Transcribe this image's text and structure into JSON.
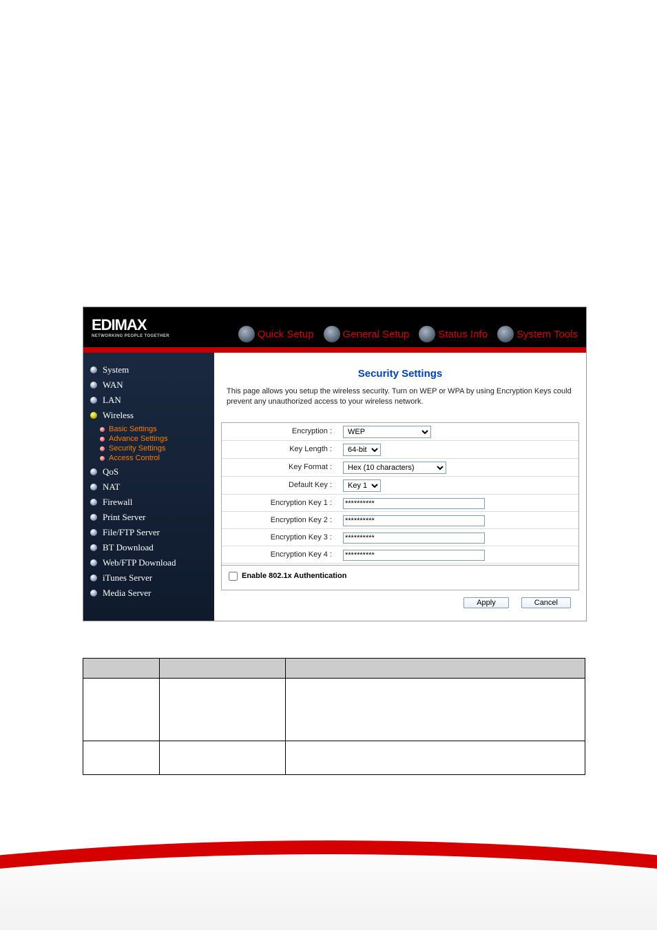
{
  "brand": {
    "name": "EDIMAX",
    "tagline": "NETWORKING PEOPLE TOGETHER"
  },
  "tabs": {
    "quick": "Quick Setup",
    "general": "General Setup",
    "status": "Status Info",
    "tools": "System Tools"
  },
  "sidebar": {
    "items": [
      {
        "label": "System"
      },
      {
        "label": "WAN"
      },
      {
        "label": "LAN"
      },
      {
        "label": "Wireless"
      },
      {
        "label": "QoS"
      },
      {
        "label": "NAT"
      },
      {
        "label": "Firewall"
      },
      {
        "label": "Print Server"
      },
      {
        "label": "File/FTP Server"
      },
      {
        "label": "BT Download"
      },
      {
        "label": "Web/FTP Download"
      },
      {
        "label": "iTunes Server"
      },
      {
        "label": "Media Server"
      }
    ],
    "wireless_sub": [
      {
        "label": "Basic Settings"
      },
      {
        "label": "Advance Settings"
      },
      {
        "label": "Security Settings"
      },
      {
        "label": "Access Control"
      }
    ]
  },
  "page": {
    "title": "Security Settings",
    "desc": "This page allows you setup the wireless security. Turn on WEP or WPA by using Encryption Keys could prevent any unauthorized access to your wireless network."
  },
  "form": {
    "labels": {
      "encryption": "Encryption :",
      "keylen": "Key Length :",
      "keyfmt": "Key Format :",
      "defkey": "Default Key :",
      "ek1": "Encryption Key 1 :",
      "ek2": "Encryption Key 2 :",
      "ek3": "Encryption Key 3 :",
      "ek4": "Encryption Key 4 :"
    },
    "values": {
      "encryption": "WEP",
      "keylen": "64-bit",
      "keyfmt": "Hex (10 characters)",
      "defkey": "Key 1",
      "ek1": "**********",
      "ek2": "**********",
      "ek3": "**********",
      "ek4": "**********"
    },
    "enable_8021x": "Enable 802.1x Authentication",
    "buttons": {
      "apply": "Apply",
      "cancel": "Cancel"
    }
  }
}
